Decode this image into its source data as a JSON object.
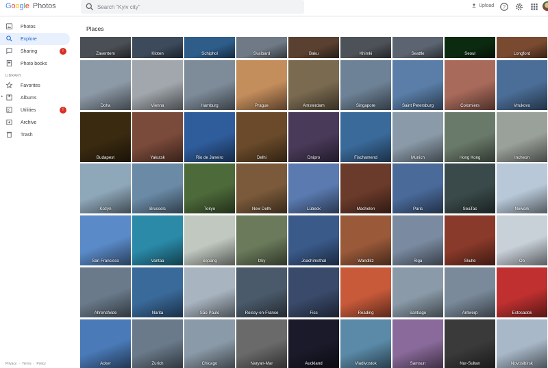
{
  "app": {
    "logo_letters": [
      "G",
      "o",
      "o",
      "g",
      "l",
      "e"
    ],
    "product": "Photos"
  },
  "search": {
    "placeholder": "Search \"Kyiv city\""
  },
  "header": {
    "upload_label": "Upload"
  },
  "sidebar": {
    "items": [
      {
        "label": "Photos",
        "icon": "image-icon"
      },
      {
        "label": "Explore",
        "icon": "search-icon",
        "active": true
      },
      {
        "label": "Sharing",
        "icon": "chat-icon",
        "badge": "!"
      },
      {
        "label": "Photo books",
        "icon": "book-icon"
      }
    ],
    "library_label": "LIBRARY",
    "library_items": [
      {
        "label": "Favorites",
        "icon": "star-icon"
      },
      {
        "label": "Albums",
        "icon": "album-icon"
      },
      {
        "label": "Utilities",
        "icon": "checklist-icon",
        "badge": "!"
      },
      {
        "label": "Archive",
        "icon": "archive-icon"
      },
      {
        "label": "Trash",
        "icon": "trash-icon"
      }
    ],
    "footer": [
      "Privacy",
      "·",
      "Terms",
      "·",
      "Policy"
    ]
  },
  "main": {
    "title": "Places",
    "rows": [
      [
        "Zaventem",
        "Kloten",
        "Schiphol",
        "Svalbard",
        "Baku",
        "Khimki",
        "Seattle",
        "Seoul",
        "Longford"
      ],
      [
        "Doha",
        "Vienna",
        "Hamburg",
        "Prague",
        "Amsterdam",
        "Singapore",
        "Saint Petersburg",
        "Colomiers",
        "Vnukovo"
      ],
      [
        "Budapest",
        "Yakutsk",
        "Rio de Janeiro",
        "Delhi",
        "Dnipro",
        "Fischamend",
        "Munich",
        "Hong Kong",
        "Incheon"
      ],
      [
        "Kozyn",
        "Brussels",
        "Tokyo",
        "New Delhi",
        "Lübeck",
        "Machelen",
        "Paris",
        "SeaTac",
        "Newark"
      ],
      [
        "San Francisco",
        "Vantaa",
        "Sepang",
        "Izky",
        "Joachimsthal",
        "Wandlitz",
        "Riga",
        "Skulte",
        "Ob"
      ],
      [
        "Ahrensfelde",
        "Narita",
        "São Paulo",
        "Roissy-en-France",
        "Fiss",
        "Reading",
        "Santiago",
        "Antwerp",
        "Estosadok"
      ],
      [
        "Acker",
        "Zurich",
        "Chicago",
        "Naryan-Mar",
        "Auckland",
        "Vladivostok",
        "Samsun",
        "Nur-Sultan",
        "Novosibirsk"
      ]
    ],
    "tile_colors": [
      [
        "#4a4f55",
        "#3c4a5c",
        "#2e5d8a",
        "#6f7a86",
        "#5a4030",
        "#4d5258",
        "#5b6470",
        "#0c2a10",
        "#7a4a30"
      ],
      [
        "#8c99a6",
        "#a1a7ad",
        "#7e8c9a",
        "#c48d5c",
        "#7a6a50",
        "#6d8296",
        "#5a7ea8",
        "#a86a5a",
        "#4b6e98"
      ],
      [
        "#3a2a10",
        "#7a4a3a",
        "#2f5d9c",
        "#6a4a2a",
        "#4a3a5a",
        "#3a6a9a",
        "#8a9aa8",
        "#6a7a6a",
        "#9aa09a"
      ],
      [
        "#8ea7b9",
        "#6a8aa6",
        "#4d6a3a",
        "#7a5a3a",
        "#5a7ab0",
        "#6a3a2a",
        "#4a6a9a",
        "#3a4a4a",
        "#b8c8d8"
      ],
      [
        "#5a8ac8",
        "#2a8aa8",
        "#c0c8c0",
        "#6a7a5a",
        "#3a5a8a",
        "#9a5a3a",
        "#7a8aa0",
        "#8a3a2a",
        "#c8d0d8"
      ],
      [
        "#6a7a8a",
        "#3a6a9a",
        "#a8b4c0",
        "#4a5a6a",
        "#3a4a6a",
        "#c85a3a",
        "#8a9aa8",
        "#7a8a9a",
        "#c03030"
      ],
      [
        "#4a7ab8",
        "#6a7a8a",
        "#8a9aa8",
        "#6a6a6a",
        "#1a1a2a",
        "#5a8aa8",
        "#8a6a9a",
        "#3a3a3a",
        "#a8b8c8"
      ]
    ]
  }
}
